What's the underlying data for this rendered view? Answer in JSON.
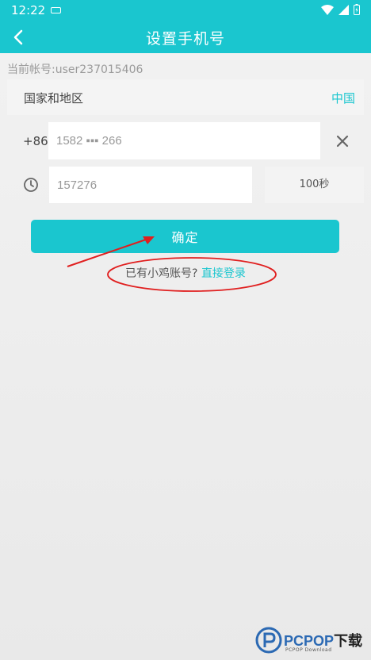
{
  "statusbar": {
    "time": "12:22"
  },
  "appbar": {
    "title": "设置手机号"
  },
  "account": {
    "text": "当前帐号:user237015406"
  },
  "country": {
    "label": "国家和地区",
    "value": "中国"
  },
  "phone": {
    "prefix": "+86",
    "value": "1582 ▪▪▪ 266"
  },
  "code": {
    "value": "157276",
    "timer": "100秒"
  },
  "confirm": {
    "label": "确定"
  },
  "hint": {
    "text": "已有小鸡账号? ",
    "link": "直接登录"
  },
  "watermark": {
    "brand": "PCPOP",
    "brand_cn": "下载",
    "sub": "PCPOP Download"
  },
  "colors": {
    "accent": "#1ac6cf",
    "annotation": "#e01f1f"
  }
}
